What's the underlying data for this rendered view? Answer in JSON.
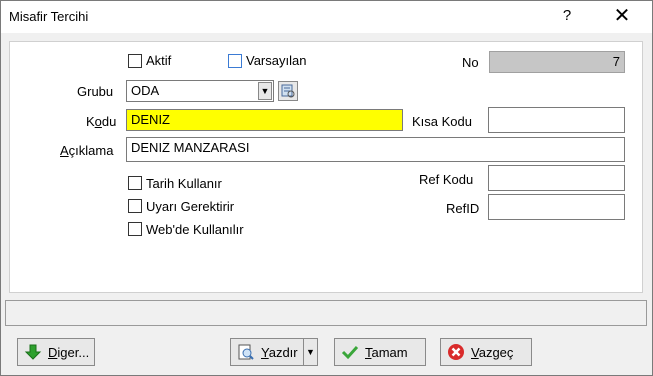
{
  "window": {
    "title": "Misafir Tercihi",
    "help": "?",
    "close": "✕"
  },
  "form": {
    "aktif": {
      "label": "Aktif",
      "checked": false
    },
    "varsayilan": {
      "label": "Varsayılan",
      "checked": false
    },
    "no": {
      "label": "No",
      "value": "7"
    },
    "grubu": {
      "label": "Grubu",
      "value": "ODA"
    },
    "kodu": {
      "label_pre": "K",
      "label_u": "o",
      "label_post": "du",
      "value": "DENIZ"
    },
    "kisa_kodu": {
      "label": "Kısa Kodu",
      "value": ""
    },
    "aciklama": {
      "label_u": "A",
      "label_post": "çıklama",
      "value": "DENIZ MANZARASI"
    },
    "tarih_kullanir": {
      "label": "Tarih Kullanır",
      "checked": false
    },
    "uyari_gerektirir": {
      "label": "Uyarı Gerektirir",
      "checked": false
    },
    "webde_kullanilir": {
      "label": "Web'de Kullanılır",
      "checked": false
    },
    "ref_kodu": {
      "label": "Ref Kodu",
      "value": ""
    },
    "ref_id": {
      "label": "RefID",
      "value": ""
    }
  },
  "buttons": {
    "diger": {
      "u": "D",
      "rest": "iger..."
    },
    "yazdir": {
      "u": "Y",
      "rest": "azdır"
    },
    "tamam": {
      "u": "T",
      "rest": "amam"
    },
    "vazgec": {
      "u": "V",
      "rest": "azgeç"
    }
  }
}
